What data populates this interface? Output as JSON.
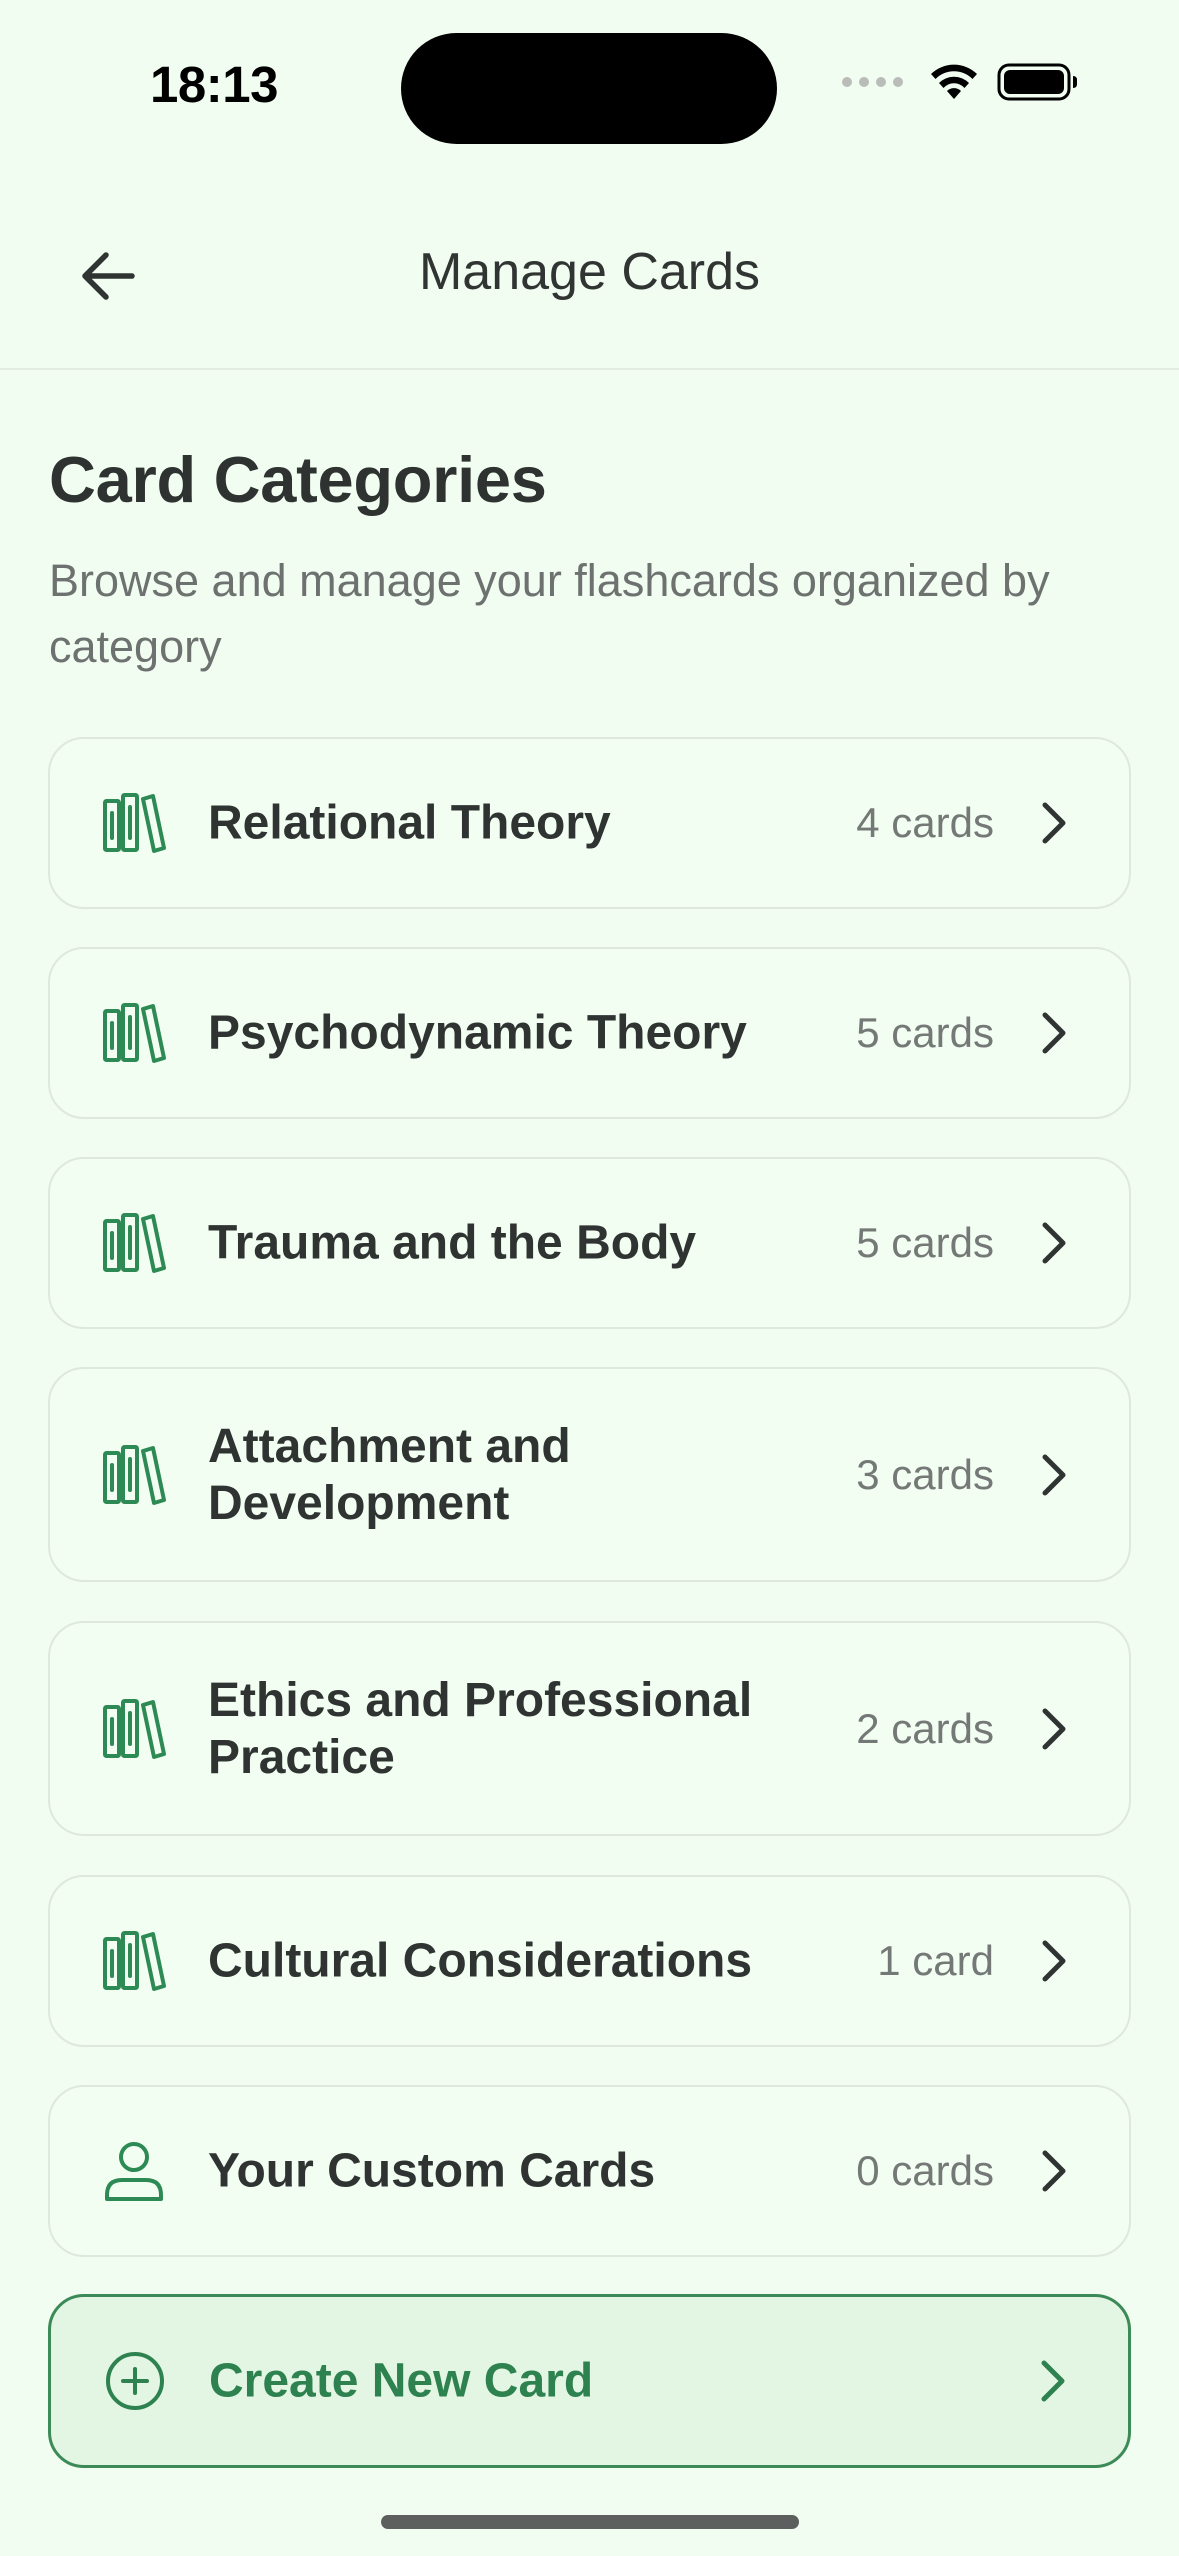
{
  "status_bar": {
    "time": "18:13",
    "icons": [
      "signal-dots-icon",
      "wifi-icon",
      "battery-icon"
    ]
  },
  "nav": {
    "title": "Manage Cards",
    "back_icon": "arrow-left-icon"
  },
  "header": {
    "title": "Card Categories",
    "subtitle": "Browse and manage your flashcards organized by category"
  },
  "categories": [
    {
      "name": "Relational Theory",
      "count": "4 cards",
      "icon": "books-icon"
    },
    {
      "name": "Psychodynamic Theory",
      "count": "5 cards",
      "icon": "books-icon"
    },
    {
      "name": "Trauma and the Body",
      "count": "5 cards",
      "icon": "books-icon"
    },
    {
      "name": "Attachment and Development",
      "count": "3 cards",
      "icon": "books-icon"
    },
    {
      "name": "Ethics and Professional Practice",
      "count": "2 cards",
      "icon": "books-icon"
    },
    {
      "name": "Cultural Considerations",
      "count": "1 card",
      "icon": "books-icon"
    },
    {
      "name": "Your Custom Cards",
      "count": "0 cards",
      "icon": "user-icon"
    }
  ],
  "create": {
    "label": "Create New Card",
    "icon": "plus-circle-icon"
  },
  "colors": {
    "background": "#f1fdf1",
    "accent_green": "#2e8250",
    "card_border": "#dfe8df",
    "create_bg": "#e3f5e3"
  }
}
